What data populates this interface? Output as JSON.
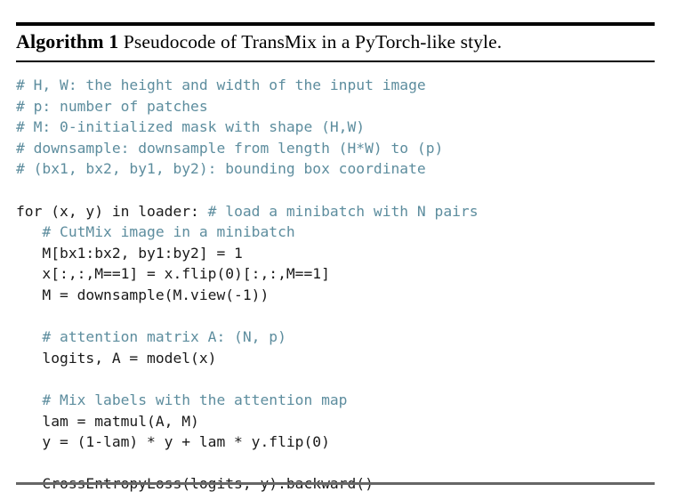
{
  "algorithm": {
    "label": "Algorithm 1",
    "caption": " Pseudocode of TransMix in a PyTorch-like style.",
    "rules": {
      "top_color": "#000000",
      "mid_color": "#000000",
      "bottom_color": "#666666"
    },
    "colors": {
      "code": "#1a1a1a",
      "comment": "#5d8d9e",
      "background": "#ffffff"
    },
    "code_lines": [
      {
        "kind": "comment",
        "text": "# H, W: the height and width of the input image"
      },
      {
        "kind": "comment",
        "text": "# p: number of patches"
      },
      {
        "kind": "comment",
        "text": "# M: 0-initialized mask with shape (H,W)"
      },
      {
        "kind": "comment",
        "text": "# downsample: downsample from length (H*W) to (p)"
      },
      {
        "kind": "comment",
        "text": "# (bx1, bx2, by1, by2): bounding box coordinate"
      },
      {
        "kind": "blank",
        "text": " "
      },
      {
        "kind": "mixed",
        "code": "for (x, y) in loader: ",
        "comment": "# load a minibatch with N pairs"
      },
      {
        "kind": "comment",
        "text": "   # CutMix image in a minibatch"
      },
      {
        "kind": "code",
        "text": "   M[bx1:bx2, by1:by2] = 1"
      },
      {
        "kind": "code",
        "text": "   x[:,:,M==1] = x.flip(0)[:,:,M==1]"
      },
      {
        "kind": "code",
        "text": "   M = downsample(M.view(-1))"
      },
      {
        "kind": "blank",
        "text": " "
      },
      {
        "kind": "comment",
        "text": "   # attention matrix A: (N, p)"
      },
      {
        "kind": "code",
        "text": "   logits, A = model(x)"
      },
      {
        "kind": "blank",
        "text": " "
      },
      {
        "kind": "comment",
        "text": "   # Mix labels with the attention map"
      },
      {
        "kind": "code",
        "text": "   lam = matmul(A, M)"
      },
      {
        "kind": "code",
        "text": "   y = (1-lam) * y + lam * y.flip(0)"
      },
      {
        "kind": "blank",
        "text": " "
      },
      {
        "kind": "code",
        "text": "   CrossEntropyLoss(logits, y).backward()"
      }
    ]
  }
}
